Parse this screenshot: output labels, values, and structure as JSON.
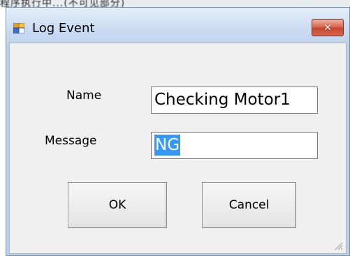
{
  "window": {
    "title": "Log Event",
    "close_glyph": "✕"
  },
  "form": {
    "name_label": "Name",
    "name_value": "Checking Motor1",
    "message_label": "Message",
    "message_value": "NG"
  },
  "buttons": {
    "ok_label": "OK",
    "cancel_label": "Cancel"
  },
  "background": {
    "partial_text": "程序执行中...(不可见部分)"
  },
  "colors": {
    "titlebar": "#c8daf1",
    "close_button": "#d8614a",
    "client": "#f0f0f0",
    "selection": "#3399ff"
  },
  "icons": {
    "app": "form-icon",
    "close": "close-icon",
    "grip": "resize-grip-icon"
  }
}
